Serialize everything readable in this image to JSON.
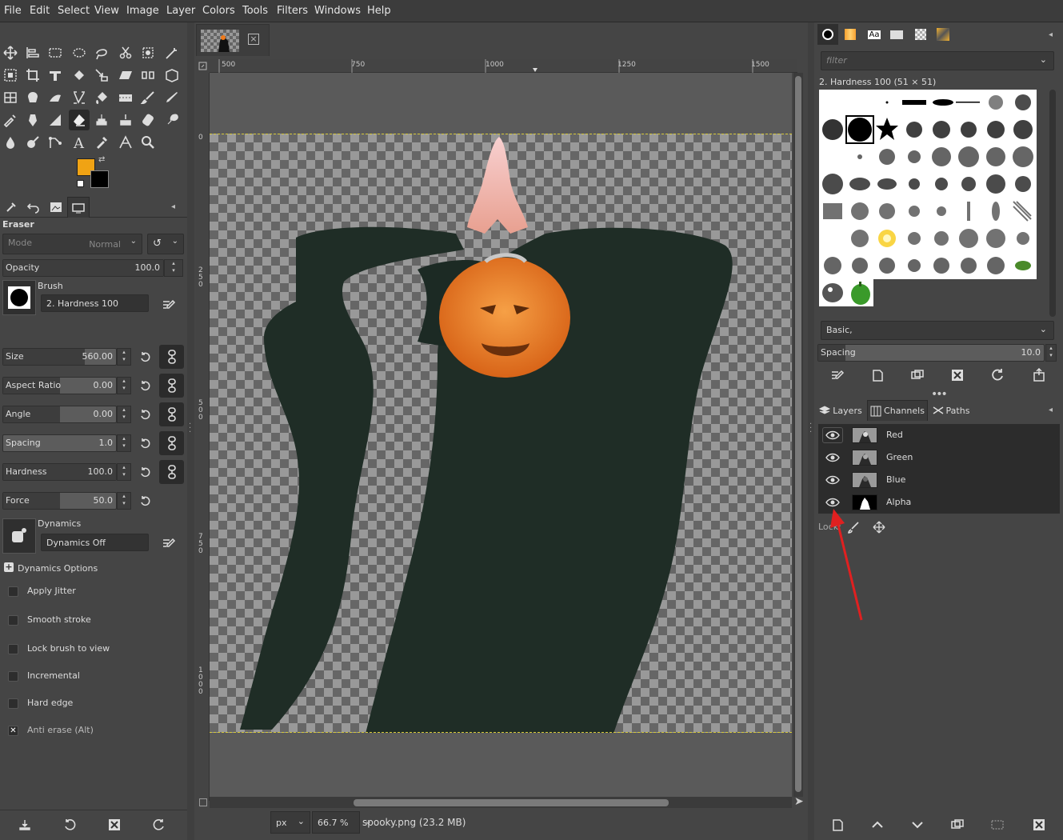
{
  "menubar": {
    "items": [
      "File",
      "Edit",
      "Select",
      "View",
      "Image",
      "Layer",
      "Colors",
      "Tools",
      "Filters",
      "Windows",
      "Help"
    ]
  },
  "toolbox": {
    "fg_color": "#f0a314",
    "bg_color": "#000000"
  },
  "tool_options": {
    "title": "Eraser",
    "mode_label": "Mode",
    "mode_value": "Normal",
    "opacity_label": "Opacity",
    "opacity_value": "100.0",
    "brush_label": "Brush",
    "brush_name": "2. Hardness 100",
    "sliders": [
      {
        "name": "Size",
        "value": "560.00",
        "fill": 0.72
      },
      {
        "name": "Aspect Ratio",
        "value": "0.00",
        "fill": 0.5
      },
      {
        "name": "Angle",
        "value": "0.00",
        "fill": 0.5
      },
      {
        "name": "Spacing",
        "value": "1.0",
        "fill": 0.0
      },
      {
        "name": "Hardness",
        "value": "100.0",
        "fill": 1.0
      },
      {
        "name": "Force",
        "value": "50.0",
        "fill": 0.5
      }
    ],
    "dynamics_label": "Dynamics",
    "dynamics_value": "Dynamics Off",
    "dynamics_options_label": "Dynamics Options",
    "checks": [
      {
        "label": "Apply Jitter",
        "checked": false
      },
      {
        "label": "Smooth stroke",
        "checked": false
      },
      {
        "label": "Lock brush to view",
        "checked": false
      },
      {
        "label": "Incremental",
        "checked": false
      },
      {
        "label": "Hard edge",
        "checked": false
      },
      {
        "label": "Anti erase  (Alt)",
        "checked": true
      }
    ]
  },
  "canvas": {
    "ruler_top": [
      "500",
      "750",
      "1000",
      "1250",
      "1500"
    ],
    "ruler_left": [
      "0",
      "250",
      "500",
      "750",
      "1000"
    ],
    "unit": "px",
    "zoom": "66.7 %",
    "status": "spooky.png (23.2 MB)"
  },
  "brushes": {
    "filter_placeholder": "filter",
    "selected_label": "2. Hardness 100 (51 × 51)",
    "tag_combo": "Basic,",
    "spacing_label": "Spacing",
    "spacing_value": "10.0"
  },
  "channels_panel": {
    "tabs": [
      "Layers",
      "Channels",
      "Paths"
    ],
    "channels": [
      "Red",
      "Green",
      "Blue",
      "Alpha"
    ],
    "lock_label": "Lock:"
  },
  "annotation": {
    "arrow_color": "#e02020"
  }
}
